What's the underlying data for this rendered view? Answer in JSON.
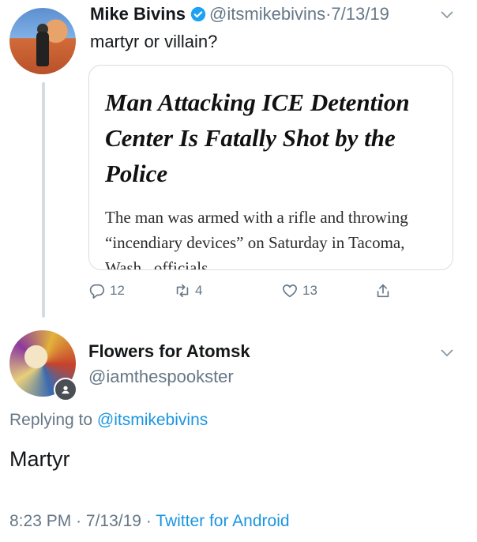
{
  "tweet1": {
    "name": "Mike Bivins",
    "handle": "@itsmikebivins",
    "separator": "·",
    "date": "7/13/19",
    "text": "martyr or villain?",
    "card": {
      "headline": "Man Attacking ICE Detention Center Is Fatally Shot by the Police",
      "description": "The man was armed with a rifle and throwing “incendiary devices” on Saturday in Tacoma, Wash., officials"
    },
    "actions": {
      "replies": "12",
      "retweets": "4",
      "likes": "13"
    }
  },
  "tweet2": {
    "name": "Flowers for Atomsk",
    "handle": "@iamthespookster",
    "replying_prefix": "Replying to",
    "replying_to": "@itsmikebivins",
    "text": "Martyr",
    "time": "8:23 PM",
    "separator": "·",
    "date": "7/13/19",
    "source": "Twitter for Android"
  },
  "colors": {
    "link": "#1b95e0",
    "muted": "#657786",
    "text": "#14171a",
    "verified": "#1da1f2"
  },
  "icons": [
    "verified-badge-icon",
    "chevron-down-icon",
    "reply-icon",
    "retweet-icon",
    "like-icon",
    "share-icon",
    "profile-badge-icon"
  ]
}
